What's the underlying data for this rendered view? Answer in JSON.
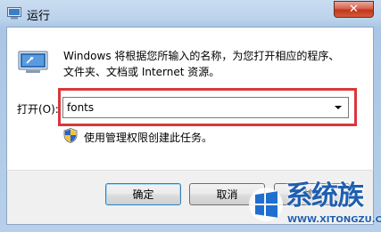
{
  "window": {
    "title": "运行",
    "close_icon": "close-icon",
    "app_icon": "run-app-icon"
  },
  "dialog": {
    "description_line1": "Windows 将根据您所输入的名称，为您打开相应的程序、",
    "description_line2": "文件夹、文档或 Internet 资源。",
    "open_label": "打开(O):",
    "open_value": "fonts",
    "admin_note": "使用管理权限创建此任务。",
    "highlight_color": "#d9373c"
  },
  "buttons": {
    "ok": "确定",
    "cancel": "取消",
    "browse": "浏览"
  },
  "watermark": {
    "text": "系统族",
    "url": "WWW.XITONGZU.COM"
  }
}
